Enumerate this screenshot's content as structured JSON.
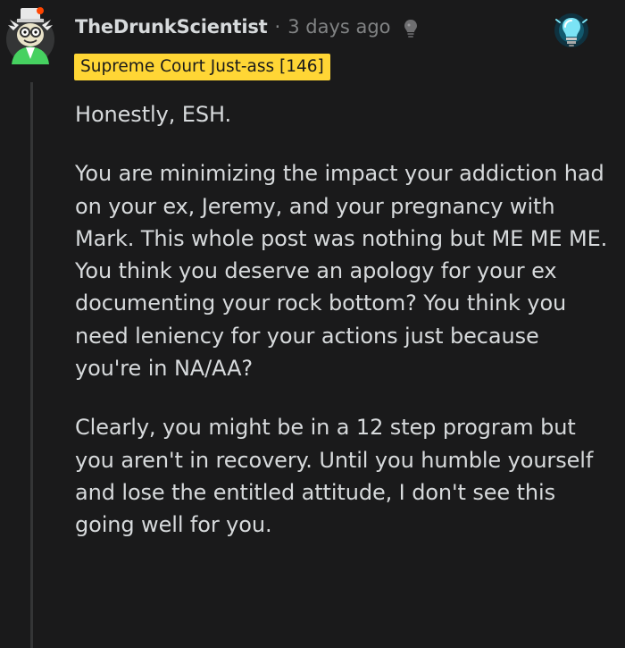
{
  "comment": {
    "username": "TheDrunkScientist",
    "separator": "·",
    "timestamp": "3 days ago",
    "flair": "Supreme Court Just-ass [146]",
    "paragraphs": [
      "Honestly, ESH.",
      "You are minimizing the impact your addiction had on your ex, Jeremy, and your pregnancy with Mark. This whole post was nothing but ME ME ME. You think you deserve an apology for your ex documenting your rock bottom? You think you need leniency for your actions just because you're in NA/AA?",
      "Clearly, you might be in a 12 step program but you aren't in recovery. Until you humble yourself and lose the entitled attitude, I don't see this going well for you."
    ]
  },
  "icons": {
    "avatar": "scientist-avatar",
    "author_badge": "lightbulb-icon",
    "award": "glowing-lightbulb-award-icon"
  },
  "colors": {
    "background": "#1a1a1b",
    "text": "#d7dadc",
    "muted": "#818384",
    "flair_bg": "#ffd635",
    "flair_text": "#1a1a1b",
    "thread_line": "#343536"
  }
}
